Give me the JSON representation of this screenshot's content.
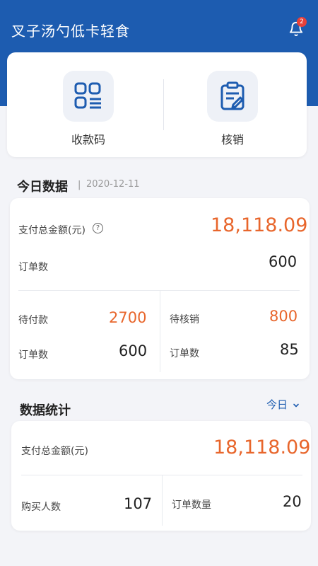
{
  "header": {
    "title": "叉子汤勺低卡轻食",
    "notification_count": "2",
    "bg_color": "#1d5cb0"
  },
  "quick_actions": [
    {
      "label": "收款码",
      "icon": "qr-code-icon"
    },
    {
      "label": "核销",
      "icon": "clipboard-verify-icon"
    }
  ],
  "today": {
    "title": "今日数据",
    "separator": "|",
    "date": "2020-12-11",
    "total_label": "支付总金额(元)",
    "help_symbol": "?",
    "total_value": "18,118.09",
    "orders_label": "订单数",
    "orders_value": "600",
    "pending_pay_label": "待付款",
    "pending_pay_value": "2700",
    "pending_pay_orders_label": "订单数",
    "pending_pay_orders_value": "600",
    "pending_verify_label": "待核销",
    "pending_verify_value": "800",
    "pending_verify_orders_label": "订单数",
    "pending_verify_orders_value": "85"
  },
  "stats": {
    "title": "数据统计",
    "period": "今日",
    "total_label": "支付总金额(元)",
    "total_value": "18,118.09",
    "buyers_label": "购买人数",
    "buyers_value": "107",
    "orders_label": "订单数量",
    "orders_value": "20"
  },
  "colors": {
    "accent": "#1d5cb0",
    "highlight": "#e8662c"
  }
}
